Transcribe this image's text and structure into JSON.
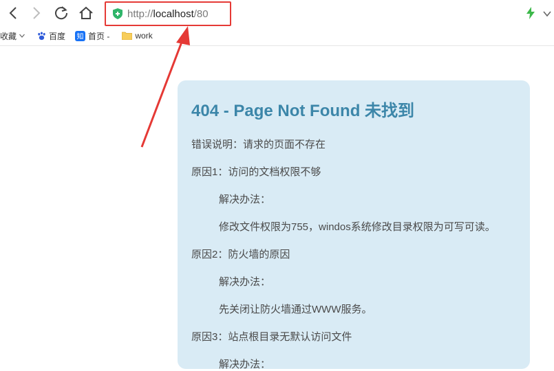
{
  "url": {
    "scheme": "http://",
    "host": "localhost",
    "path": "/80"
  },
  "bookmarks": [
    {
      "label": "收藏",
      "icon": "chevron-down-icon"
    },
    {
      "label": "百度",
      "icon": "baidu-paw-icon"
    },
    {
      "label": "首页 -",
      "icon": "zhihu-icon"
    },
    {
      "label": "work",
      "icon": "folder-icon"
    }
  ],
  "page": {
    "title": "404 - Page Not Found 未找到",
    "lines": [
      "错误说明：请求的页面不存在",
      "原因1：访问的文档权限不够",
      "解决办法：",
      "修改文件权限为755，windos系统修改目录权限为可写可读。",
      "原因2：防火墙的原因",
      "解决办法：",
      "先关闭让防火墙通过WWW服务。",
      "原因3：站点根目录无默认访问文件",
      "解决办法："
    ]
  },
  "colors": {
    "card_bg": "#d9ebf5",
    "title": "#3c86a9",
    "highlight": "#e53935",
    "security_badge": "#2fb56a"
  }
}
